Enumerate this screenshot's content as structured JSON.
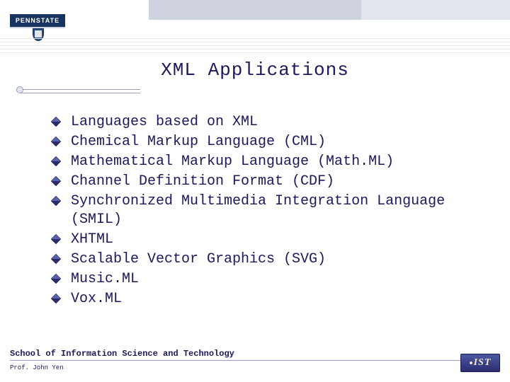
{
  "header": {
    "logo_text": "PENNSTATE"
  },
  "title": "XML Applications",
  "items": [
    "Languages based on XML",
    "Chemical Markup Language (CML)",
    "Mathematical Markup Language (Math.ML)",
    "Channel Definition Format (CDF)",
    "Synchronized Multimedia Integration Language (SMIL)",
    "XHTML",
    "Scalable Vector Graphics (SVG)",
    "Music.ML",
    "Vox.ML"
  ],
  "footer": {
    "school": "School of Information Science and Technology",
    "professor": "Prof. John Yen",
    "badge": "IST"
  }
}
